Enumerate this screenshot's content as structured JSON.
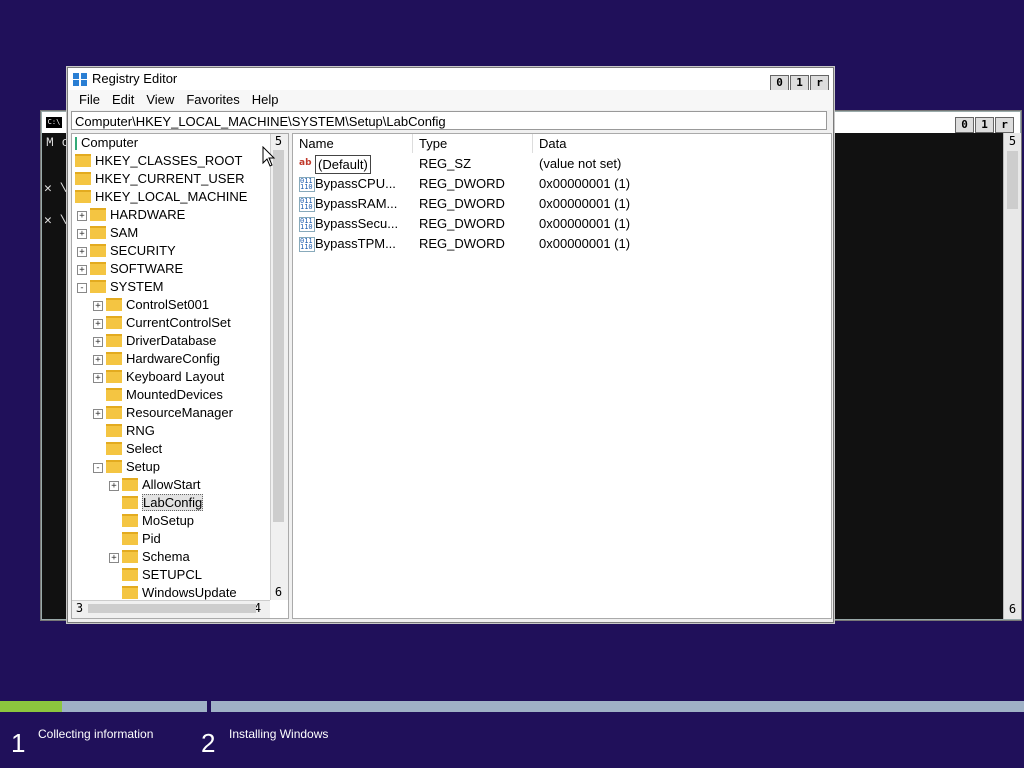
{
  "console": {
    "title_icon": "C:\\",
    "lines": [
      "M c",
      "✕ \\",
      "✕ \\"
    ],
    "controls": {
      "min": "0",
      "max": "1",
      "close": "r"
    },
    "scroll_up": "5",
    "scroll_down": "6"
  },
  "registry": {
    "title": "Registry Editor",
    "controls": {
      "min": "0",
      "max": "1",
      "close": "r"
    },
    "menu": [
      "File",
      "Edit",
      "View",
      "Favorites",
      "Help"
    ],
    "address": "Computer\\HKEY_LOCAL_MACHINE\\SYSTEM\\Setup\\LabConfig",
    "tree": [
      {
        "label": "Computer",
        "level": 0,
        "toggle": "",
        "folder": false
      },
      {
        "label": "HKEY_CLASSES_ROOT",
        "level": 0,
        "toggle": "",
        "folder": true
      },
      {
        "label": "HKEY_CURRENT_USER",
        "level": 0,
        "toggle": "",
        "folder": true
      },
      {
        "label": "HKEY_LOCAL_MACHINE",
        "level": 0,
        "toggle": "",
        "folder": true
      },
      {
        "label": "HARDWARE",
        "level": 1,
        "toggle": "+",
        "folder": true
      },
      {
        "label": "SAM",
        "level": 1,
        "toggle": "+",
        "folder": true
      },
      {
        "label": "SECURITY",
        "level": 1,
        "toggle": "+",
        "folder": true
      },
      {
        "label": "SOFTWARE",
        "level": 1,
        "toggle": "+",
        "folder": true
      },
      {
        "label": "SYSTEM",
        "level": 1,
        "toggle": "-",
        "folder": true
      },
      {
        "label": "ControlSet001",
        "level": 2,
        "toggle": "+",
        "folder": true
      },
      {
        "label": "CurrentControlSet",
        "level": 2,
        "toggle": "+",
        "folder": true
      },
      {
        "label": "DriverDatabase",
        "level": 2,
        "toggle": "+",
        "folder": true
      },
      {
        "label": "HardwareConfig",
        "level": 2,
        "toggle": "+",
        "folder": true
      },
      {
        "label": "Keyboard Layout",
        "level": 2,
        "toggle": "+",
        "folder": true
      },
      {
        "label": "MountedDevices",
        "level": 2,
        "toggle": "",
        "folder": true
      },
      {
        "label": "ResourceManager",
        "level": 2,
        "toggle": "+",
        "folder": true
      },
      {
        "label": "RNG",
        "level": 2,
        "toggle": "",
        "folder": true
      },
      {
        "label": "Select",
        "level": 2,
        "toggle": "",
        "folder": true
      },
      {
        "label": "Setup",
        "level": 2,
        "toggle": "-",
        "folder": true
      },
      {
        "label": "AllowStart",
        "level": 3,
        "toggle": "+",
        "folder": true
      },
      {
        "label": "LabConfig",
        "level": 3,
        "toggle": "",
        "folder": true,
        "selected": true
      },
      {
        "label": "MoSetup",
        "level": 3,
        "toggle": "",
        "folder": true
      },
      {
        "label": "Pid",
        "level": 3,
        "toggle": "",
        "folder": true
      },
      {
        "label": "Schema",
        "level": 3,
        "toggle": "+",
        "folder": true
      },
      {
        "label": "SETUPCL",
        "level": 3,
        "toggle": "",
        "folder": true
      },
      {
        "label": "WindowsUpdate",
        "level": 3,
        "toggle": "",
        "folder": true
      }
    ],
    "tree_scroll": {
      "up": "5",
      "down": "6",
      "left": "3",
      "right": "4"
    },
    "columns": [
      "Name",
      "Type",
      "Data"
    ],
    "values": [
      {
        "icon": "string-value-icon",
        "glyph": "ab",
        "name": "(Default)",
        "type": "REG_SZ",
        "data": "(value not set)"
      },
      {
        "icon": "binary-value-icon",
        "glyph": "011\n110",
        "name": "BypassCPU...",
        "type": "REG_DWORD",
        "data": "0x00000001 (1)"
      },
      {
        "icon": "binary-value-icon",
        "glyph": "011\n110",
        "name": "BypassRAM...",
        "type": "REG_DWORD",
        "data": "0x00000001 (1)"
      },
      {
        "icon": "binary-value-icon",
        "glyph": "011\n110",
        "name": "BypassSecu...",
        "type": "REG_DWORD",
        "data": "0x00000001 (1)"
      },
      {
        "icon": "binary-value-icon",
        "glyph": "011\n110",
        "name": "BypassTPM...",
        "type": "REG_DWORD",
        "data": "0x00000001 (1)"
      }
    ]
  },
  "setup": {
    "progress_fraction": 0.06,
    "steps": [
      {
        "number": "1",
        "label": "Collecting information"
      },
      {
        "number": "2",
        "label": "Installing Windows"
      }
    ],
    "colors": {
      "background": "#20105a",
      "bar_done": "#8cc63e",
      "bar_track": "#9fb1c6"
    }
  }
}
